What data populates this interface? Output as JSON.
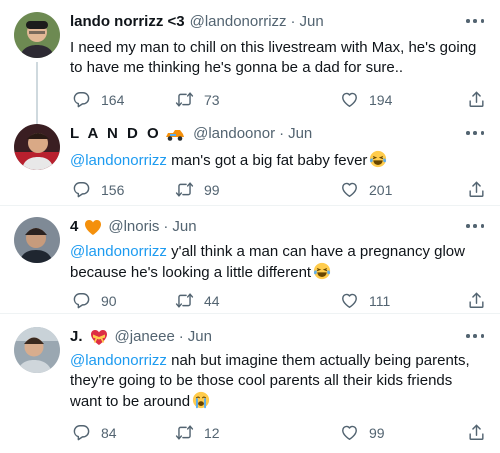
{
  "tweets": [
    {
      "name": "lando norrizz <3",
      "handle": "@landonorrizz",
      "time": "Jun",
      "text": "I need my man to chill on this livestream with Max, he's going to have me thinking he's gonna be a dad for sure..",
      "mention": "",
      "replies": "164",
      "retweets": "73",
      "likes": "194"
    },
    {
      "name": "L A N D O",
      "name_emoji": "race-car-emoji",
      "handle": "@landoonor",
      "time": "Jun",
      "mention": "@landonorrizz",
      "text": " man's got a big fat baby fever",
      "text_emoji": "laughing-tears-emoji",
      "replies": "156",
      "retweets": "99",
      "likes": "201"
    },
    {
      "name": "4",
      "name_emoji": "orange-heart-emoji",
      "handle": "@lnoris",
      "time": "Jun",
      "mention": "@landonorrizz",
      "text": " y'all think a man can have a pregnancy glow because he's looking a little different",
      "text_emoji": "laughing-tears-emoji",
      "replies": "90",
      "retweets": "44",
      "likes": "111"
    },
    {
      "name": "J.",
      "name_emoji": "heart-with-ribbon-emoji",
      "handle": "@janeee",
      "time": "Jun",
      "mention": "@landonorrizz",
      "text": " nah but imagine them actually being parents, they're going to be those cool parents all their kids friends want to be around",
      "text_emoji": "crying-emoji",
      "replies": "84",
      "retweets": "12",
      "likes": "99"
    }
  ],
  "icons": {
    "reply": "reply-icon",
    "retweet": "retweet-icon",
    "like": "heart-icon",
    "share": "share-icon",
    "more": "more-options-icon"
  },
  "colors": {
    "text": "#0f1419",
    "secondary": "#536471",
    "link": "#1d9bf0",
    "thread_line": "#cfd9de",
    "divider": "#eff3f4"
  }
}
